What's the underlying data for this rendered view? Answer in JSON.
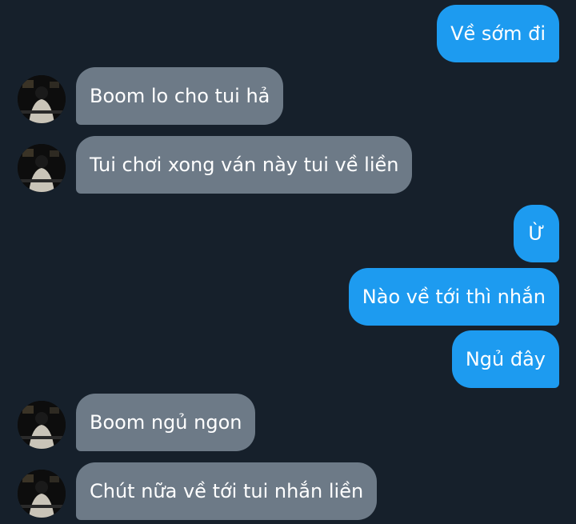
{
  "conversation": {
    "messages": [
      {
        "direction": "sent",
        "text": "Về sớm đi"
      },
      {
        "direction": "received",
        "text": "Boom lo cho tui hả",
        "avatar": "contact-avatar"
      },
      {
        "direction": "received",
        "text": "Tui chơi xong ván này tui về liền",
        "avatar": "contact-avatar"
      },
      {
        "direction": "sent",
        "text": "Ừ"
      },
      {
        "direction": "sent",
        "text": "Nào về tới thì nhắn"
      },
      {
        "direction": "sent",
        "text": "Ngủ đây"
      },
      {
        "direction": "received",
        "text": "Boom ngủ ngon",
        "avatar": "contact-avatar"
      },
      {
        "direction": "received",
        "text": "Chút nữa về tới tui nhắn liền",
        "avatar": "contact-avatar"
      }
    ]
  },
  "colors": {
    "background": "#16202b",
    "sent_bubble": "#1d9bf0",
    "received_bubble": "#6d7a87",
    "text": "#ffffff"
  }
}
